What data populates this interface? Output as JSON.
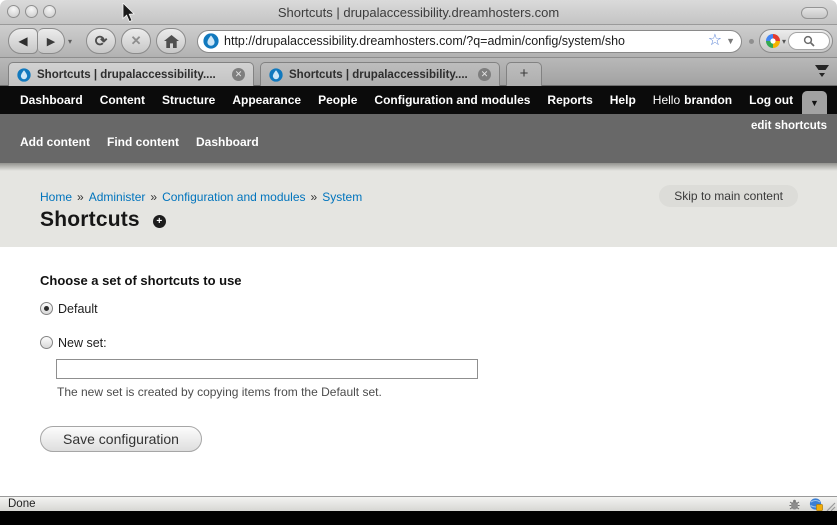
{
  "window": {
    "title": "Shortcuts | drupalaccessibility.dreamhosters.com"
  },
  "browser": {
    "url": "http://drupalaccessibility.dreamhosters.com/?q=admin/config/system/sho",
    "tabs": [
      {
        "label": "Shortcuts | drupalaccessibility...."
      },
      {
        "label": "Shortcuts | drupalaccessibility...."
      }
    ],
    "new_tab": "+",
    "search_engine": "Google"
  },
  "icons": {
    "back": "◀",
    "forward": "▶",
    "reload": "⟳",
    "stop": "✕",
    "caret": "▼",
    "small_caret": "▾",
    "star": "☆",
    "tab_close": "✕"
  },
  "admin_toolbar": {
    "items": [
      "Dashboard",
      "Content",
      "Structure",
      "Appearance",
      "People",
      "Configuration and modules",
      "Reports",
      "Help"
    ],
    "greeting": "Hello",
    "username": "brandon",
    "logout": "Log out"
  },
  "shortcut_bar": {
    "items": [
      "Add content",
      "Find content",
      "Dashboard"
    ],
    "edit_label": "edit shortcuts"
  },
  "page": {
    "breadcrumb": {
      "items": [
        "Home",
        "Administer",
        "Configuration and modules",
        "System"
      ],
      "separator": "»"
    },
    "skip_link": "Skip to main content",
    "title": "Shortcuts",
    "add_badge": "+"
  },
  "form": {
    "heading": "Choose a set of shortcuts to use",
    "options": [
      {
        "label": "Default",
        "checked": true
      },
      {
        "label": "New set:",
        "checked": false
      }
    ],
    "new_set_value": "",
    "description": "The new set is created by copying items from the Default set.",
    "save_label": "Save configuration"
  },
  "statusbar": {
    "text": "Done"
  },
  "colors": {
    "link_blue": "#0074BD",
    "drupal_blue": "#1179BE",
    "toolbar_black": "#0b0b0b"
  }
}
